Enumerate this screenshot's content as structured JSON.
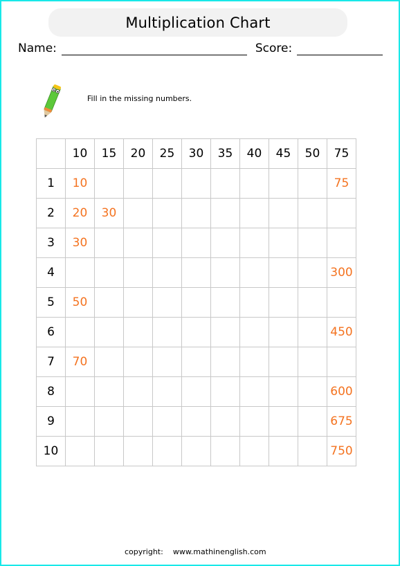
{
  "header": {
    "title": "Multiplication Chart"
  },
  "form": {
    "name_label": "Name:",
    "score_label": "Score:"
  },
  "instruction": "Fill in the missing numbers.",
  "colors": {
    "answer": "#f47320",
    "border": "#18e8e8",
    "grid": "#c8c8c8"
  },
  "table": {
    "column_headers": [
      "",
      "10",
      "15",
      "20",
      "25",
      "30",
      "35",
      "40",
      "45",
      "50",
      "75"
    ],
    "rows": [
      {
        "label": "1",
        "cells": [
          "10",
          "",
          "",
          "",
          "",
          "",
          "",
          "",
          "",
          "75"
        ]
      },
      {
        "label": "2",
        "cells": [
          "20",
          "30",
          "",
          "",
          "",
          "",
          "",
          "",
          "",
          ""
        ]
      },
      {
        "label": "3",
        "cells": [
          "30",
          "",
          "",
          "",
          "",
          "",
          "",
          "",
          "",
          ""
        ]
      },
      {
        "label": "4",
        "cells": [
          "",
          "",
          "",
          "",
          "",
          "",
          "",
          "",
          "",
          "300"
        ]
      },
      {
        "label": "5",
        "cells": [
          "50",
          "",
          "",
          "",
          "",
          "",
          "",
          "",
          "",
          ""
        ]
      },
      {
        "label": "6",
        "cells": [
          "",
          "",
          "",
          "",
          "",
          "",
          "",
          "",
          "",
          "450"
        ]
      },
      {
        "label": "7",
        "cells": [
          "70",
          "",
          "",
          "",
          "",
          "",
          "",
          "",
          "",
          ""
        ]
      },
      {
        "label": "8",
        "cells": [
          "",
          "",
          "",
          "",
          "",
          "",
          "",
          "",
          "",
          "600"
        ]
      },
      {
        "label": "9",
        "cells": [
          "",
          "",
          "",
          "",
          "",
          "",
          "",
          "",
          "",
          "675"
        ]
      },
      {
        "label": "10",
        "cells": [
          "",
          "",
          "",
          "",
          "",
          "",
          "",
          "",
          "",
          "750"
        ]
      }
    ]
  },
  "footer": {
    "copyright_label": "copyright:",
    "url": "www.mathinenglish.com"
  },
  "icons": {
    "pencil": "pencil-mascot-icon"
  }
}
